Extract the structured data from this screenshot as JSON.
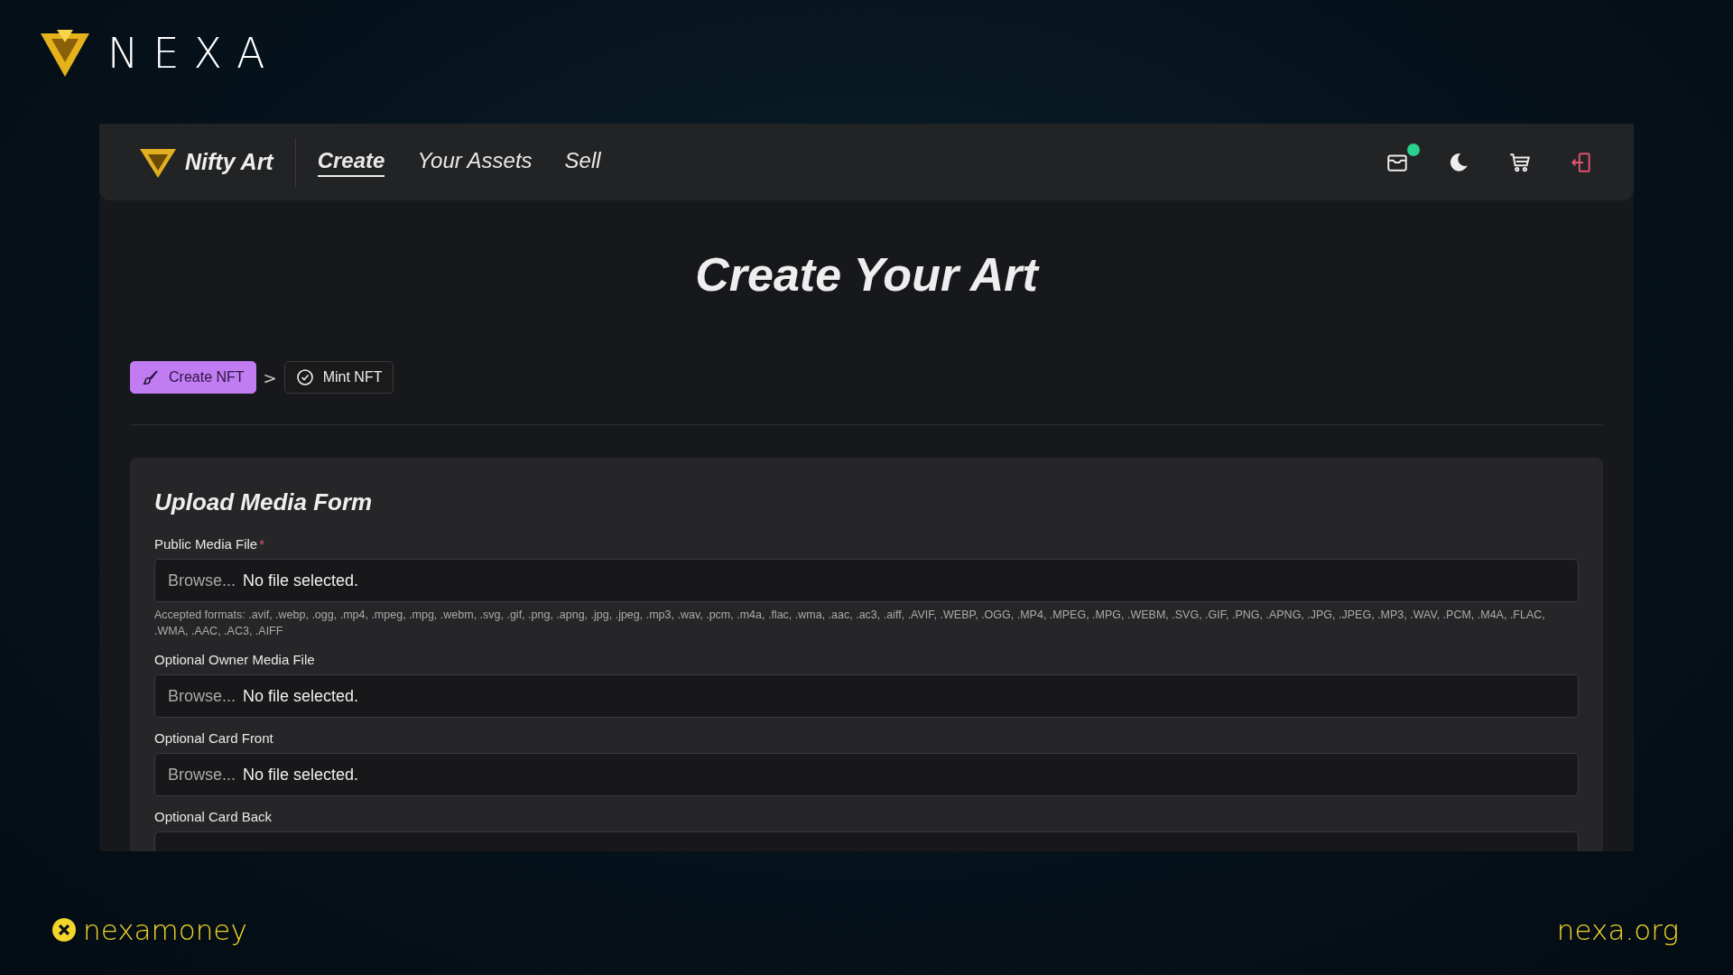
{
  "brand": {
    "name": "NEXA"
  },
  "app": {
    "logo": "Nifty Art",
    "nav": [
      {
        "label": "Create",
        "selected": true
      },
      {
        "label": "Your Assets",
        "selected": false
      },
      {
        "label": "Sell",
        "selected": false
      }
    ],
    "wallet_connected": true
  },
  "page_title": "Create Your Art",
  "steps": [
    {
      "label": "Create NFT",
      "kind": "brush",
      "selected": true
    },
    {
      "label": "Mint NFT",
      "kind": "check",
      "selected": false
    }
  ],
  "step_separator": ">",
  "form": {
    "title": "Upload Media Form",
    "fields": [
      {
        "label": "Public Media File",
        "required": true,
        "button": "Browse...",
        "value": "No file selected.",
        "help": "Accepted formats: .avif, .webp, .ogg, .mp4, .mpeg, .mpg, .webm, .svg, .gif, .png, .apng, .jpg, .jpeg, .mp3, .wav, .pcm, .m4a, .flac, .wma, .aac, .ac3, .aiff, .AVIF, .WEBP, .OGG, .MP4, .MPEG, .MPG, .WEBM, .SVG, .GIF, .PNG, .APNG, .JPG, .JPEG, .MP3, .WAV, .PCM, .M4A, .FLAC, .WMA, .AAC, .AC3, .AIFF"
      },
      {
        "label": "Optional Owner Media File",
        "required": false,
        "button": "Browse...",
        "value": "No file selected."
      },
      {
        "label": "Optional Card Front",
        "required": false,
        "button": "Browse...",
        "value": "No file selected."
      },
      {
        "label": "Optional Card Back",
        "required": false
      }
    ],
    "required_mark": "*"
  },
  "footer": {
    "left": "nexamoney",
    "right": "nexa.org"
  }
}
